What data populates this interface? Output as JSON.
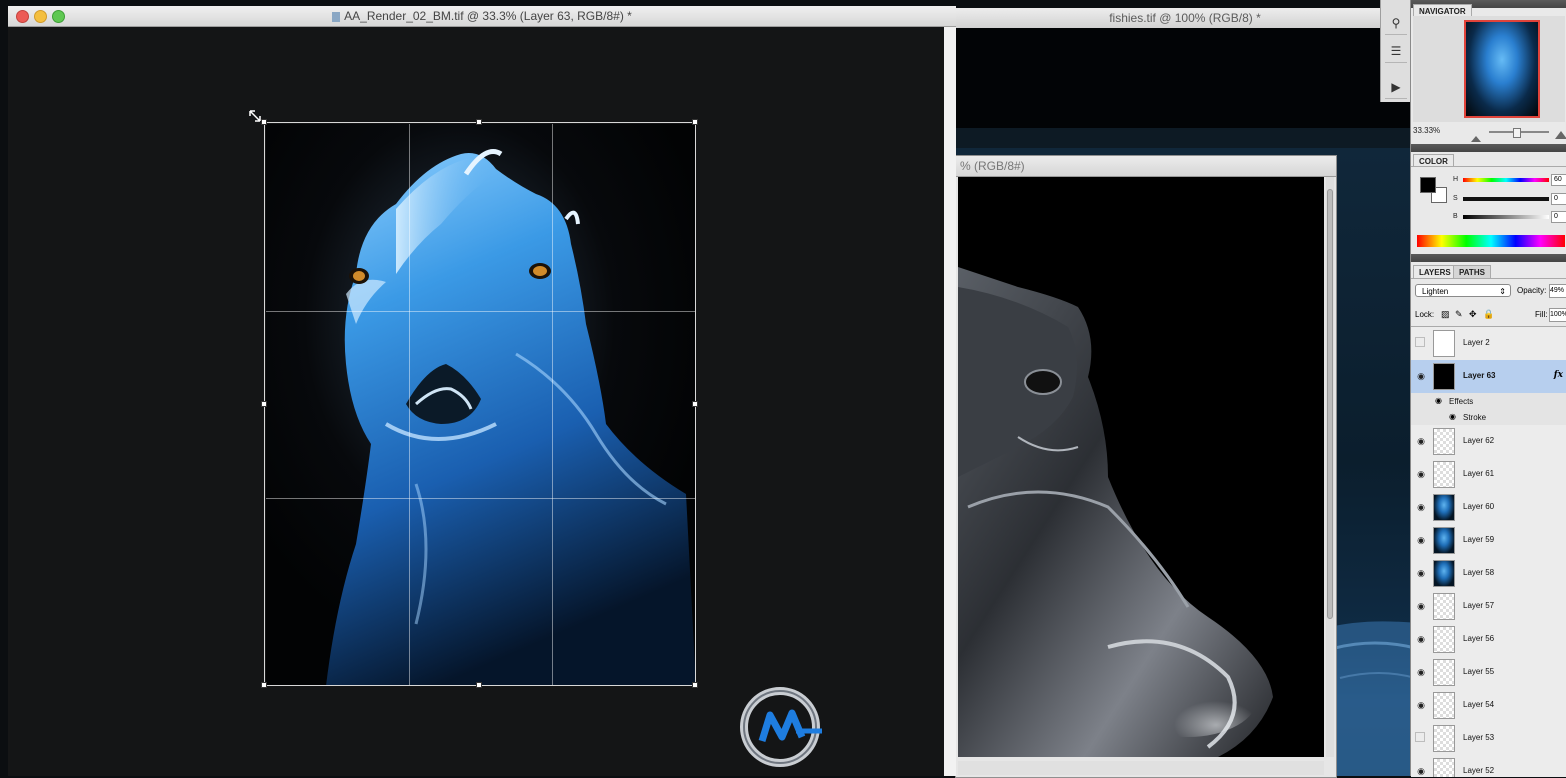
{
  "front_window": {
    "title": "AA_Render_02_BM.tif @ 33.3% (Layer 63, RGB/8#) *"
  },
  "back_window": {
    "title": "fishies.tif @ 100% (RGB/8) *"
  },
  "inner_window": {
    "title": "% (RGB/8#)"
  },
  "navigator": {
    "tab": "NAVIGATOR",
    "zoom": "33.33%"
  },
  "color": {
    "tab": "COLOR",
    "h_label": "H",
    "s_label": "S",
    "b_label": "B",
    "h_value": "60",
    "s_value": "0",
    "b_value": "0"
  },
  "layers": {
    "tab_layers": "LAYERS",
    "tab_paths": "PATHS",
    "blend_mode": "Lighten",
    "opacity_label": "Opacity:",
    "opacity_value": "49%",
    "lock_label": "Lock:",
    "fill_label": "Fill:",
    "fill_value": "100%",
    "fx": "fx",
    "effects_label": "Effects",
    "stroke_label": "Stroke",
    "items": [
      {
        "name": "Layer 2",
        "visible": false,
        "thumb": "white"
      },
      {
        "name": "Layer 63",
        "visible": true,
        "thumb": "black",
        "selected": true
      },
      {
        "name": "Layer 62",
        "visible": true,
        "thumb": "transparent"
      },
      {
        "name": "Layer 61",
        "visible": true,
        "thumb": "transparent"
      },
      {
        "name": "Layer 60",
        "visible": true,
        "thumb": "creature"
      },
      {
        "name": "Layer 59",
        "visible": true,
        "thumb": "creature"
      },
      {
        "name": "Layer 58",
        "visible": true,
        "thumb": "creature"
      },
      {
        "name": "Layer 57",
        "visible": true,
        "thumb": "transparent"
      },
      {
        "name": "Layer 56",
        "visible": true,
        "thumb": "transparent"
      },
      {
        "name": "Layer 55",
        "visible": true,
        "thumb": "transparent"
      },
      {
        "name": "Layer 54",
        "visible": true,
        "thumb": "transparent"
      },
      {
        "name": "Layer 53",
        "visible": false,
        "thumb": "transparent"
      },
      {
        "name": "Layer 52",
        "visible": true,
        "thumb": "transparent"
      }
    ]
  },
  "colors": {
    "selected_row": "#b7cfee",
    "creature_blue": "#2a86d6",
    "canvas_bg": "#141516"
  }
}
